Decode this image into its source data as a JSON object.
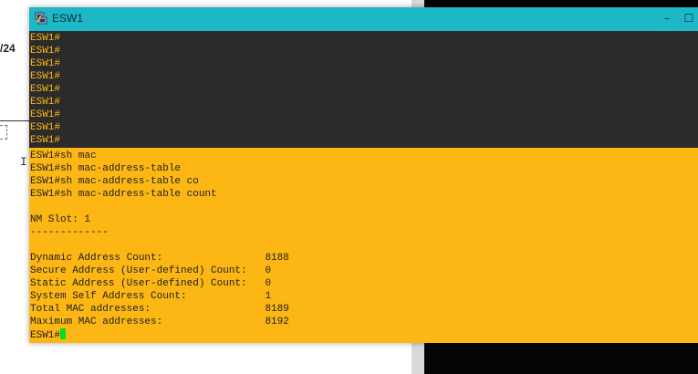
{
  "background": {
    "left_text": "/24",
    "right_panel_color": "#d9d9d9"
  },
  "window": {
    "title": "ESW1",
    "icon": "putty-terminal-icon",
    "titlebar_color": "#1cb8c8",
    "minimize_glyph": "–",
    "maximize_glyph": "☐"
  },
  "terminal": {
    "colors": {
      "background": "#2b2b2b",
      "text": "#fdb714",
      "highlight": "#fdb714",
      "highlight_text": "#1e1e1e",
      "cursor": "#00e020"
    },
    "dark_lines": [
      "ESW1#",
      "ESW1#",
      "ESW1#",
      "ESW1#",
      "ESW1#",
      "ESW1#",
      "ESW1#",
      "ESW1#",
      "ESW1#"
    ],
    "yellow_lines": [
      "ESW1#sh mac",
      "ESW1#sh mac-address-table",
      "ESW1#sh mac-address-table co",
      "ESW1#sh mac-address-table count",
      "",
      "NM Slot: 1",
      "-------------",
      "",
      "Dynamic Address Count:                 8188",
      "Secure Address (User-defined) Count:   0",
      "Static Address (User-defined) Count:   0",
      "System Self Address Count:             1",
      "Total MAC addresses:                   8189",
      "Maximum MAC addresses:                 8192"
    ],
    "prompt": "ESW1#"
  }
}
